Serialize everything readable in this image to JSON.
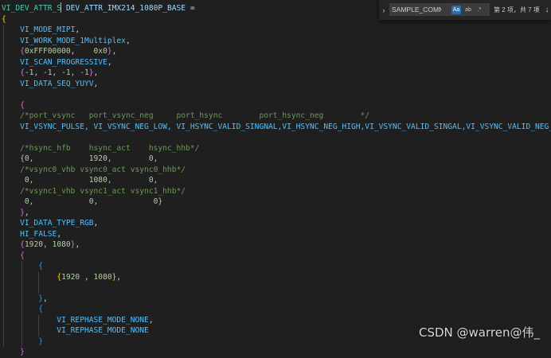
{
  "code": {
    "lines": [
      [
        {
          "t": "VI_DEV_ATTR_S",
          "c": "type"
        },
        {
          "t": " ",
          "c": "op"
        },
        {
          "t": "DEV_ATTR_IMX214_1080P_BASE",
          "c": "var"
        },
        {
          "t": " =",
          "c": "op"
        }
      ],
      [
        {
          "t": "{",
          "c": "brace-y"
        }
      ],
      [
        {
          "t": "    VI_MODE_MIPI",
          "c": "const"
        },
        {
          "t": ",",
          "c": "punc"
        }
      ],
      [
        {
          "t": "    VI_WORK_MODE_1Multiplex",
          "c": "const"
        },
        {
          "t": ",",
          "c": "punc"
        }
      ],
      [
        {
          "t": "    ",
          "c": "punc"
        },
        {
          "t": "{",
          "c": "brace-p"
        },
        {
          "t": "0xFFF00000",
          "c": "num"
        },
        {
          "t": ",    ",
          "c": "punc"
        },
        {
          "t": "0x0",
          "c": "num"
        },
        {
          "t": "}",
          "c": "brace-p"
        },
        {
          "t": ",",
          "c": "punc"
        }
      ],
      [
        {
          "t": "    VI_SCAN_PROGRESSIVE",
          "c": "const"
        },
        {
          "t": ",",
          "c": "punc"
        }
      ],
      [
        {
          "t": "    ",
          "c": "punc"
        },
        {
          "t": "{",
          "c": "brace-p"
        },
        {
          "t": "-1, -1, -1, -1",
          "c": "num"
        },
        {
          "t": "}",
          "c": "brace-p"
        },
        {
          "t": ",",
          "c": "punc"
        }
      ],
      [
        {
          "t": "    VI_DATA_SEQ_YUYV",
          "c": "const"
        },
        {
          "t": ",",
          "c": "punc"
        }
      ],
      [],
      [
        {
          "t": "    ",
          "c": "punc"
        },
        {
          "t": "{",
          "c": "brace-p"
        }
      ],
      [
        {
          "t": "    /*port_vsync   port_vsync_neg     port_hsync        port_hsync_neg        */",
          "c": "comment"
        }
      ],
      [
        {
          "t": "    VI_VSYNC_PULSE, VI_VSYNC_NEG_LOW, VI_HSYNC_VALID_SINGNAL,VI_HSYNC_NEG_HIGH,VI_VSYNC_VALID_SINGAL,VI_VSYNC_VALID_NEG_HIGH,",
          "c": "const"
        }
      ],
      [],
      [
        {
          "t": "    /*hsync_hfb    hsync_act    hsync_hhb*/",
          "c": "comment"
        }
      ],
      [
        {
          "t": "    {0,            1920,        0,",
          "c": "num"
        }
      ],
      [
        {
          "t": "    /*vsync0_vhb vsync0_act vsync0_hhb*/",
          "c": "comment"
        }
      ],
      [
        {
          "t": "     0,            1080,        0,",
          "c": "num"
        }
      ],
      [
        {
          "t": "    /*vsync1_vhb vsync1_act vsync1_hhb*/",
          "c": "comment"
        }
      ],
      [
        {
          "t": "     0,            0,            0}",
          "c": "num"
        }
      ],
      [
        {
          "t": "    ",
          "c": "punc"
        },
        {
          "t": "}",
          "c": "brace-p"
        },
        {
          "t": ",",
          "c": "punc"
        }
      ],
      [
        {
          "t": "    VI_DATA_TYPE_RGB",
          "c": "const"
        },
        {
          "t": ",",
          "c": "punc"
        }
      ],
      [
        {
          "t": "    HI_FALSE",
          "c": "const"
        },
        {
          "t": ",",
          "c": "punc"
        }
      ],
      [
        {
          "t": "    ",
          "c": "punc"
        },
        {
          "t": "{",
          "c": "brace-p"
        },
        {
          "t": "1920, 1080",
          "c": "num"
        },
        {
          "t": "}",
          "c": "brace-p"
        },
        {
          "t": ",",
          "c": "punc"
        }
      ],
      [
        {
          "t": "    ",
          "c": "punc"
        },
        {
          "t": "{",
          "c": "brace-p"
        }
      ],
      [
        {
          "t": "        ",
          "c": "punc"
        },
        {
          "t": "{",
          "c": "brace-b"
        }
      ],
      [
        {
          "t": "            ",
          "c": "punc"
        },
        {
          "t": "{",
          "c": "brace-y"
        },
        {
          "t": "1920 , 1080",
          "c": "num"
        },
        {
          "t": "}",
          "c": "brace-y"
        },
        {
          "t": ",",
          "c": "punc"
        }
      ],
      [],
      [
        {
          "t": "        ",
          "c": "punc"
        },
        {
          "t": "}",
          "c": "brace-b"
        },
        {
          "t": ",",
          "c": "punc"
        }
      ],
      [
        {
          "t": "        ",
          "c": "punc"
        },
        {
          "t": "{",
          "c": "brace-b"
        }
      ],
      [
        {
          "t": "            VI_REPHASE_MODE_NONE",
          "c": "const"
        },
        {
          "t": ",",
          "c": "punc"
        }
      ],
      [
        {
          "t": "            VI_REPHASE_MODE_NONE",
          "c": "const"
        }
      ],
      [
        {
          "t": "        ",
          "c": "punc"
        },
        {
          "t": "}",
          "c": "brace-b"
        }
      ],
      [
        {
          "t": "    ",
          "c": "punc"
        },
        {
          "t": "}",
          "c": "brace-p"
        }
      ]
    ]
  },
  "find": {
    "toggle_icon": "chevron-right-icon",
    "query": "SAMPLE_COMM_S",
    "match_case_label": "Aa",
    "whole_word_label": "ab",
    "regex_label": ".*",
    "match_count": "第 2 项，共 7 项",
    "prev_icon": "arrow-up-icon",
    "next_icon": "arrow-down-icon"
  },
  "watermark": "CSDN @warren@伟_",
  "colors": {
    "background": "#1f1f1f",
    "type": "#4ec9b0",
    "variable": "#9cdcfe",
    "constant": "#4fc1ff",
    "number": "#b5cea8",
    "comment": "#6a9955",
    "bracket_gold": "#ffd700",
    "bracket_purple": "#da70d6",
    "bracket_blue": "#179fff",
    "match_case_active": "#2d6fb7"
  }
}
